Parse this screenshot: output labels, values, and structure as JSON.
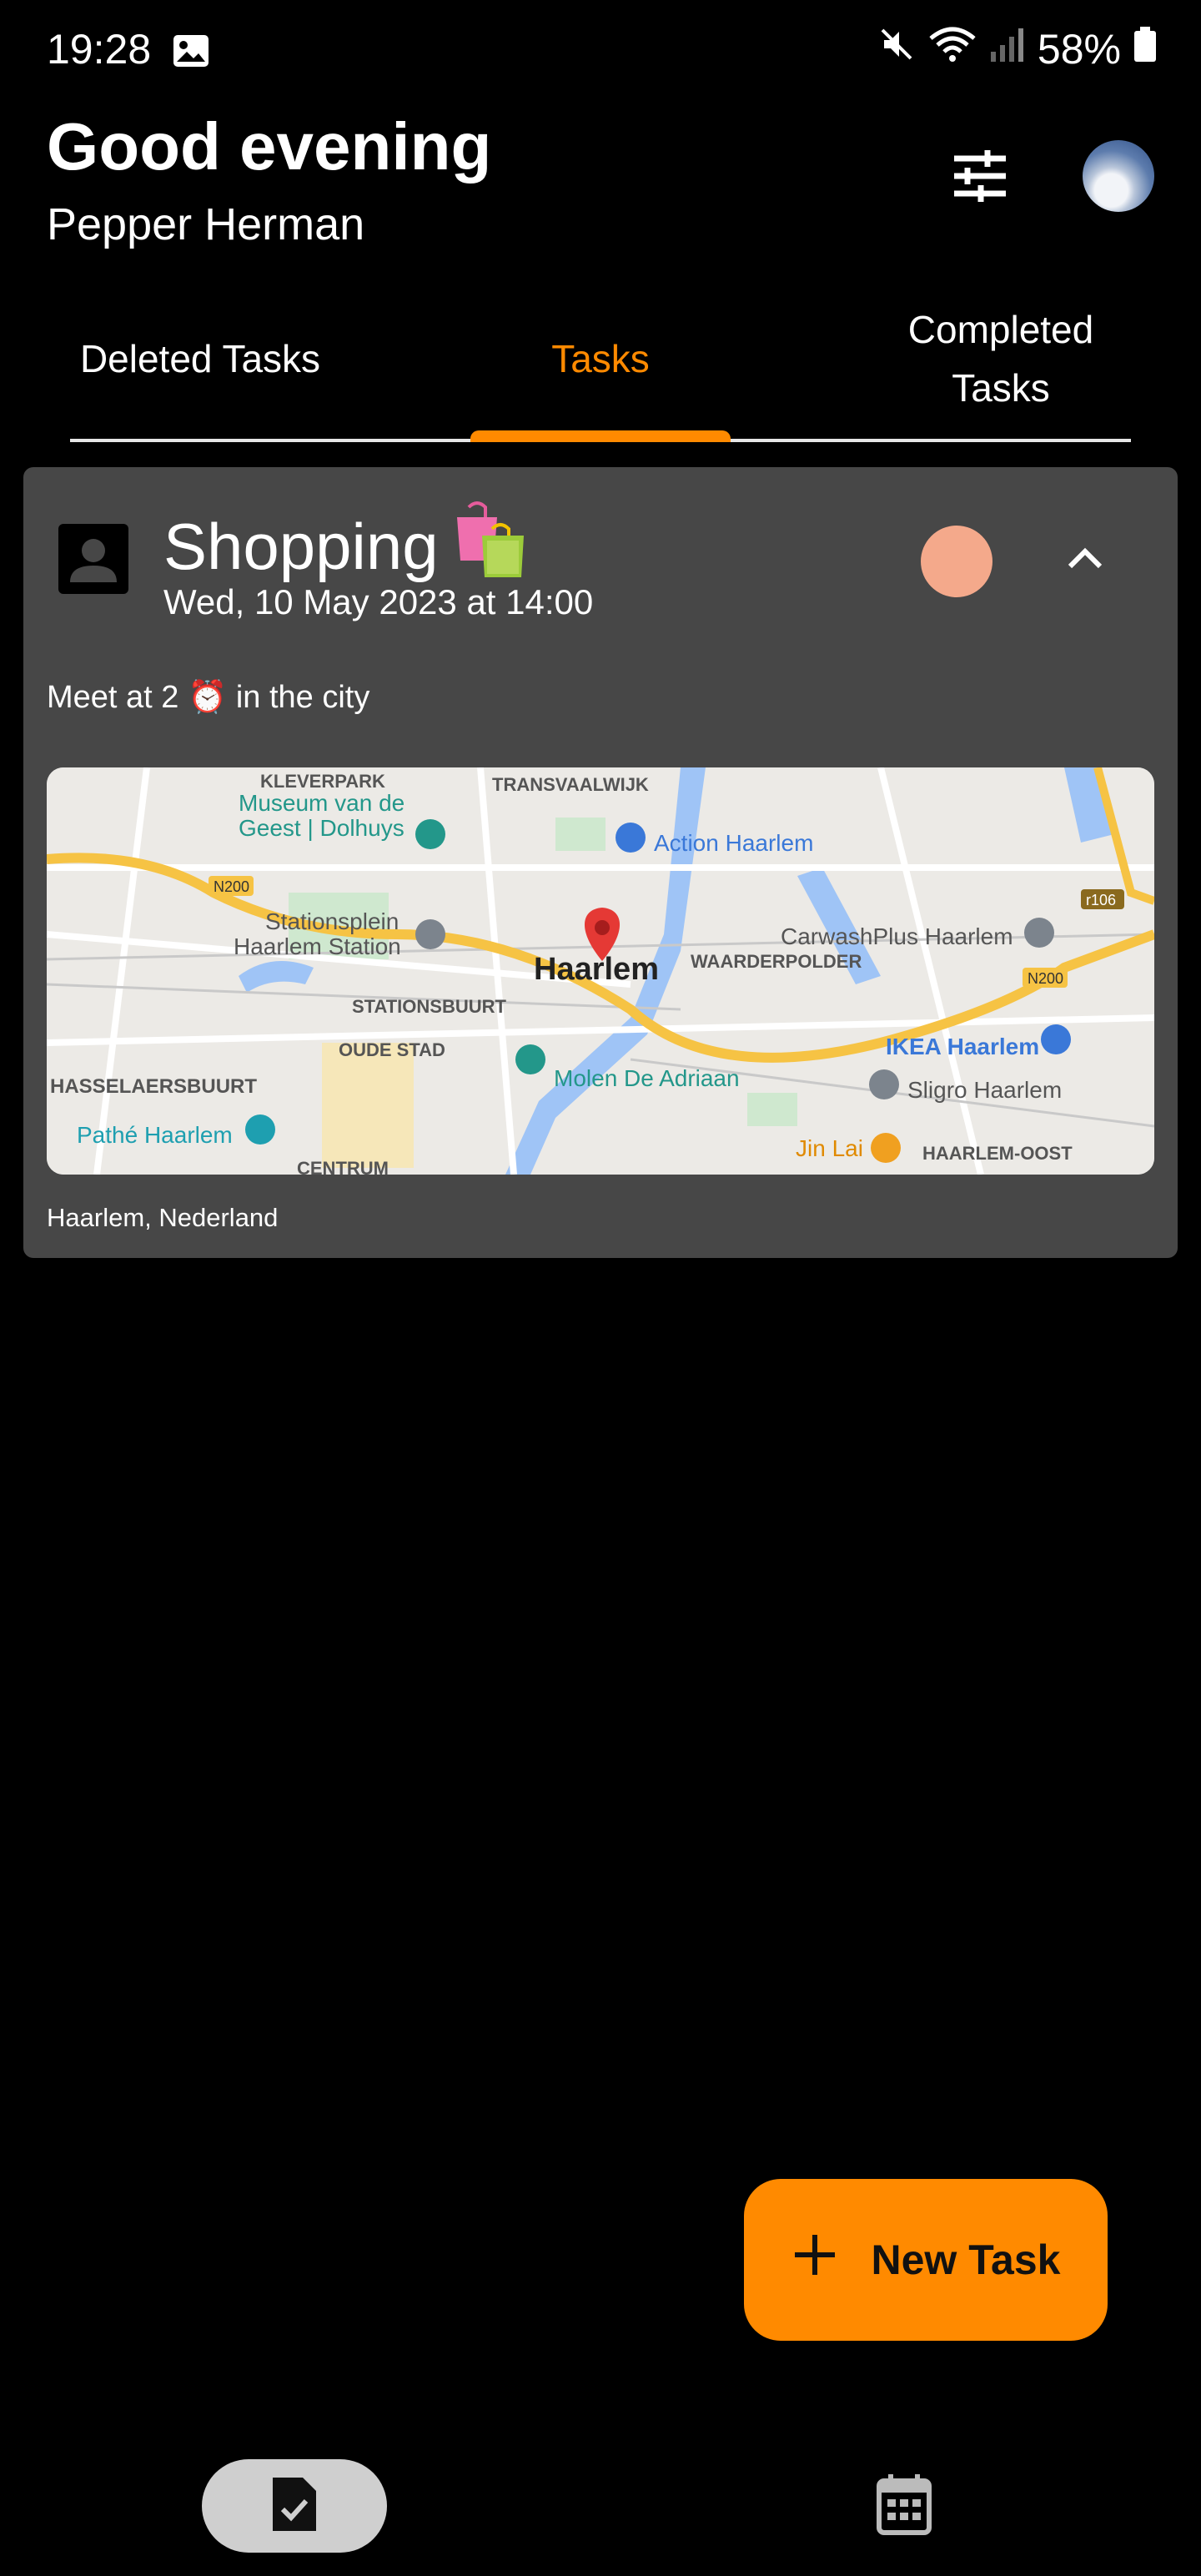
{
  "status_bar": {
    "time": "19:28",
    "battery": "58%",
    "icons": [
      "gallery-icon",
      "mute-icon",
      "wifi-icon",
      "signal-icon",
      "battery-icon"
    ]
  },
  "header": {
    "greeting": "Good evening",
    "user_name": "Pepper Herman",
    "filter_icon": "tune-icon",
    "avatar": "profile-avatar"
  },
  "tabs": [
    {
      "label": "Deleted Tasks",
      "active": false
    },
    {
      "label": "Tasks",
      "active": true
    },
    {
      "label": "Completed Tasks",
      "active": false
    }
  ],
  "task": {
    "title": "Shopping",
    "title_emoji": "🛍️",
    "date": "Wed, 10 May 2023 at 14:00",
    "description": "Meet at 2 ⏰ in the city",
    "location": "Haarlem, Nederland",
    "color": "#f4a98b",
    "icon": "person-icon",
    "map": {
      "center_label": "Haarlem",
      "labels": [
        "KLEVERPARK",
        "TRANSVAALWIJK",
        "Museum van de Geest | Dolhuys",
        "Action Haarlem",
        "N200",
        "Stationsplein Haarlem Station",
        "CarwashPlus Haarlem",
        "r106",
        "WAARDERPOLDER",
        "STATIONSBUURT",
        "N200",
        "OUDE STAD",
        "IKEA Haarlem",
        "HASSELAERSBUURT",
        "Molen De Adriaan",
        "Sligro Haarlem",
        "Pathé Haarlem",
        "Jin Lai",
        "HAARLEM-OOST",
        "CENTRUM"
      ]
    }
  },
  "fab": {
    "label": "New Task",
    "icon": "plus-icon"
  },
  "bottom_nav": [
    {
      "name": "tasks",
      "icon": "task-document-icon",
      "active": true
    },
    {
      "name": "calendar",
      "icon": "calendar-icon",
      "active": false
    }
  ],
  "colors": {
    "accent": "#ff8a00",
    "card": "#474747",
    "background": "#000000"
  }
}
